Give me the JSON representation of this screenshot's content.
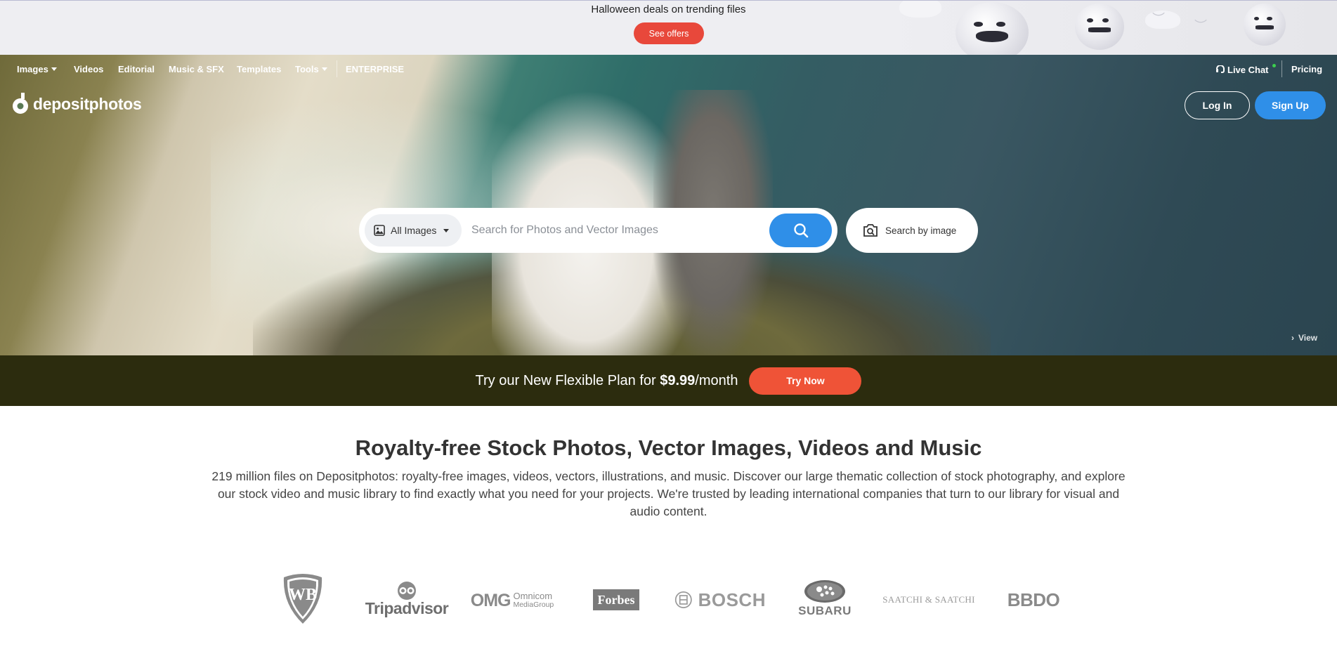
{
  "promo": {
    "text": "Halloween deals on trending files",
    "button": "See offers"
  },
  "nav": {
    "items": [
      {
        "label": "Images",
        "dropdown": true
      },
      {
        "label": "Videos",
        "dropdown": false
      },
      {
        "label": "Editorial",
        "dropdown": false
      },
      {
        "label": "Music & SFX",
        "dropdown": false
      },
      {
        "label": "Templates",
        "dropdown": false
      },
      {
        "label": "Tools",
        "dropdown": true
      },
      {
        "label": "ENTERPRISE",
        "dropdown": false
      }
    ],
    "live_chat": "Live Chat",
    "pricing": "Pricing"
  },
  "brand": {
    "name": "depositphotos"
  },
  "auth": {
    "login": "Log In",
    "signup": "Sign Up"
  },
  "search": {
    "type_label": "All Images",
    "placeholder": "Search for Photos and Vector Images",
    "by_image": "Search by image"
  },
  "hero": {
    "view_label": "View"
  },
  "plan": {
    "text_before": "Try our New Flexible Plan for ",
    "price": "$9.99",
    "text_after": "/month",
    "button": "Try Now"
  },
  "content": {
    "headline": "Royalty-free Stock Photos, Vector Images, Videos and Music",
    "description": "219 million files on Depositphotos: royalty-free images, videos, vectors, illustrations, and music. Discover our large thematic collection of stock photography, and explore our stock video and music library to find exactly what you need for your projects. We're trusted by leading international companies that turn to our library for visual and audio content."
  },
  "clients": [
    {
      "name": "Warner Bros",
      "text": "WB"
    },
    {
      "name": "Tripadvisor",
      "text": "Tripadvisor"
    },
    {
      "name": "Omnicom Media Group",
      "text": "OMG",
      "sub1": "Omnicom",
      "sub2": "MediaGroup"
    },
    {
      "name": "Forbes",
      "text": "Forbes"
    },
    {
      "name": "Bosch",
      "text": "BOSCH"
    },
    {
      "name": "Subaru",
      "text": "SUBARU"
    },
    {
      "name": "Saatchi & Saatchi",
      "text": "SAATCHI & SAATCHI"
    },
    {
      "name": "BBDO",
      "text": "BBDO"
    }
  ],
  "colors": {
    "accent_blue": "#2f8fe8",
    "promo_red": "#e8483b",
    "plan_bg": "#2c2c0e",
    "plan_button": "#ef5337"
  }
}
